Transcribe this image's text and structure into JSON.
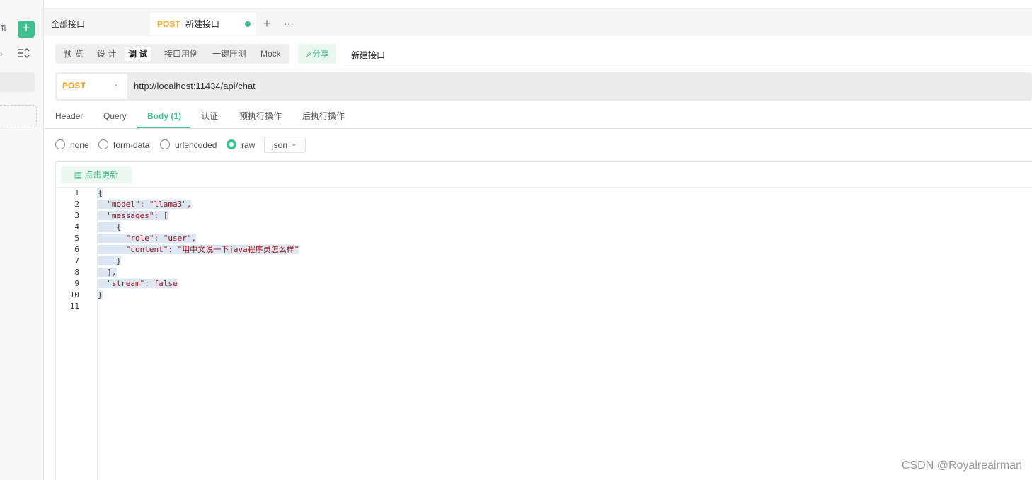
{
  "sidebar": {
    "add_label": "+"
  },
  "tabs": {
    "all_label": "全部接口",
    "active": {
      "method": "POST",
      "title": "新建接口"
    },
    "plus": "+",
    "more": "···"
  },
  "modes": {
    "items": [
      "预 览",
      "设 计",
      "调 试",
      "接口用例",
      "一键压测",
      "Mock"
    ],
    "active_index": 2,
    "share": "分享"
  },
  "doc_name": "新建接口",
  "request": {
    "method": "POST",
    "url": "http://localhost:11434/api/chat"
  },
  "req_tabs": [
    "Header",
    "Query",
    "Body (1)",
    "认证",
    "预执行操作",
    "后执行操作"
  ],
  "body_types": {
    "options": [
      "none",
      "form-data",
      "urlencoded",
      "raw"
    ],
    "selected": "raw",
    "format": "json"
  },
  "editor": {
    "refresh_label": "点击更新",
    "line_numbers": [
      "1",
      "2",
      "3",
      "4",
      "5",
      "6",
      "7",
      "8",
      "9",
      "10",
      "11"
    ],
    "lines": [
      "{",
      "  \"model\": \"llama3\",",
      "  \"messages\": [",
      "    {",
      "      \"role\": \"user\",",
      "      \"content\": \"用中文说一下java程序员怎么样\"",
      "    }",
      "  ],",
      "  \"stream\": false",
      "}",
      ""
    ]
  },
  "watermark": "CSDN @Royalreairman",
  "colors": {
    "accent": "#3fbf8f",
    "method": "#f5a623"
  }
}
